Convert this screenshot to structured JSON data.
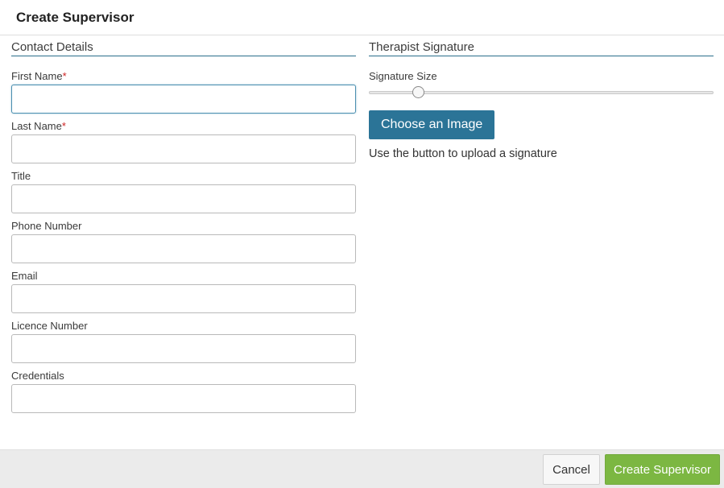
{
  "header": {
    "title": "Create Supervisor"
  },
  "contact": {
    "section_title": "Contact Details",
    "required_mark": "*",
    "fields": [
      {
        "label": "First Name",
        "required": true,
        "value": ""
      },
      {
        "label": "Last Name",
        "required": true,
        "value": ""
      },
      {
        "label": "Title",
        "required": false,
        "value": ""
      },
      {
        "label": "Phone Number",
        "required": false,
        "value": ""
      },
      {
        "label": "Email",
        "required": false,
        "value": ""
      },
      {
        "label": "Licence Number",
        "required": false,
        "value": ""
      },
      {
        "label": "Credentials",
        "required": false,
        "value": ""
      }
    ]
  },
  "signature": {
    "section_title": "Therapist Signature",
    "size_label": "Signature Size",
    "size_slider_fraction": 0.13,
    "choose_button": "Choose an Image",
    "help_text": "Use the button to upload a signature"
  },
  "footer": {
    "cancel_label": "Cancel",
    "create_label": "Create Supervisor"
  },
  "colors": {
    "primary": "#2b7497",
    "success": "#7cb742",
    "required": "#cc2222"
  }
}
